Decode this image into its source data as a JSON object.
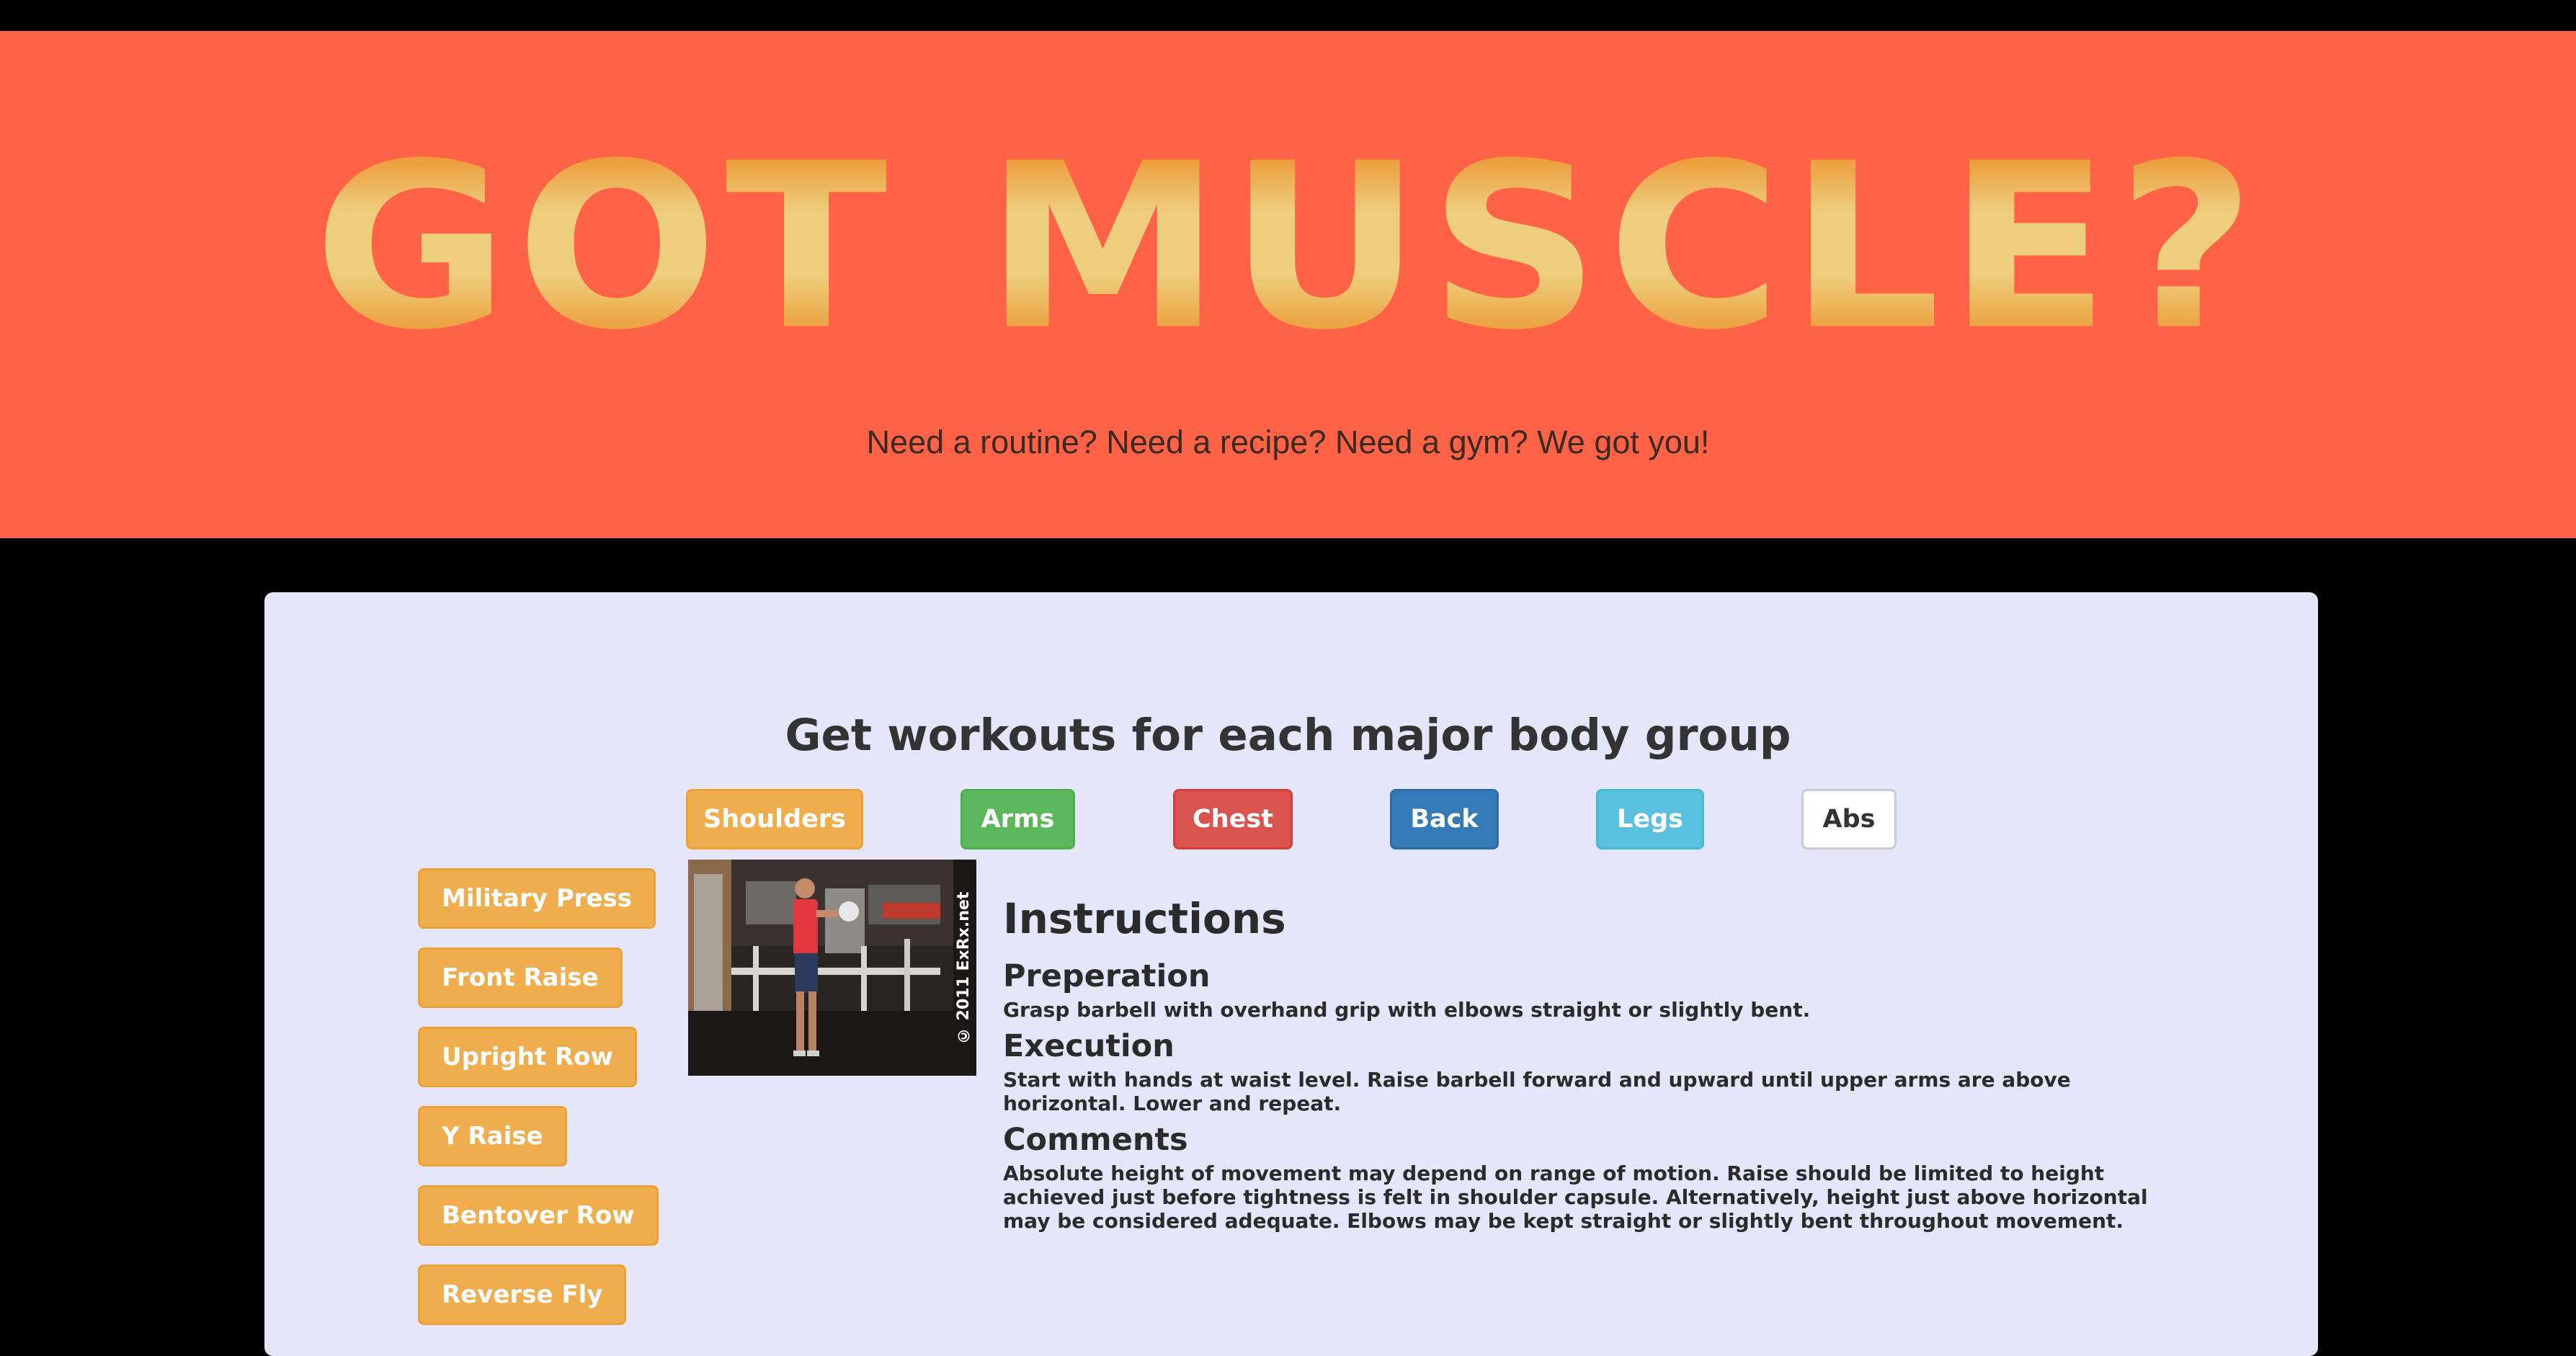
{
  "hero": {
    "title": "GOT MUSCLE?",
    "subtitle": "Need a routine? Need a recipe? Need a gym? We got you!",
    "background": "#ff6347",
    "title_gradient": [
      "#ed8219",
      "#edce7c"
    ]
  },
  "main": {
    "heading": "Get workouts for each major body group",
    "body_groups": [
      {
        "label": "Shoulders",
        "color": "#f0ad4e"
      },
      {
        "label": "Arms",
        "color": "#5cb85c"
      },
      {
        "label": "Chest",
        "color": "#d9534f"
      },
      {
        "label": "Back",
        "color": "#337ab7"
      },
      {
        "label": "Legs",
        "color": "#5bc0de"
      },
      {
        "label": "Abs",
        "color": "#ffffff"
      }
    ],
    "exercises": [
      "Military Press",
      "Front Raise",
      "Upright Row",
      "Y Raise",
      "Bentover Row",
      "Reverse Fly"
    ],
    "image": {
      "watermark": "© 2011 ExRx.net"
    },
    "instructions": {
      "title": "Instructions",
      "preparation_heading": "Preperation",
      "preparation_text": "Grasp barbell with overhand grip with elbows straight or slightly bent.",
      "execution_heading": "Execution",
      "execution_text": "Start with hands at waist level. Raise barbell forward and upward until upper arms are above horizontal. Lower and repeat.",
      "comments_heading": "Comments",
      "comments_text": "Absolute height of movement may depend on range of motion. Raise should be limited to height achieved just before tightness is felt in shoulder capsule. Alternatively, height just above horizontal may be considered adequate. Elbows may be kept straight or slightly bent throughout movement."
    }
  }
}
